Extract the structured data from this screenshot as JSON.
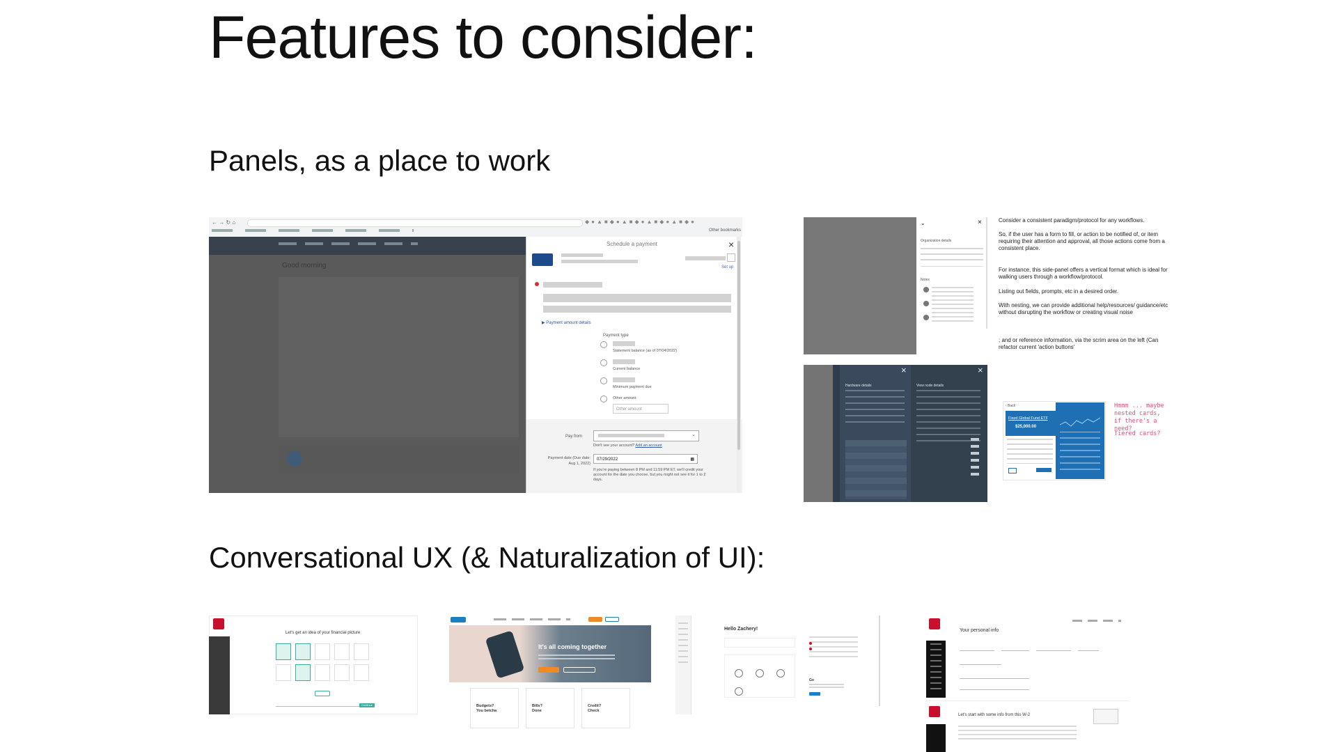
{
  "headings": {
    "title": "Features to consider:",
    "panels": "Panels, as a place to work",
    "conversational": "Conversational UX (& Naturalization of UI):"
  },
  "shot1": {
    "panel_title": "Schedule a payment",
    "setup": "Set up",
    "payment_details": "Payment amount details",
    "payment_type": "Payment type",
    "options": [
      "Statement balance (as of 07/04/2022)",
      "Current balance",
      "Minimum payment due",
      "Other amount"
    ],
    "other_amount_placeholder": "Other amount",
    "pay_from": "Pay from",
    "dont_see": "Don't see your account?",
    "add_account": "Add an account",
    "payment_date_label": "Payment date (Due date: Aug 1, 2022)",
    "payment_date": "07/29/2022",
    "note": "If you're paying between 8 PM and 11:59 PM ET, we'll credit your account for the date you choose, but you might not see it for 1 to 2 days.",
    "greeting": "Good morning",
    "other_bookmarks": "Other bookmarks"
  },
  "shot2": {
    "notes": [
      "Consider a consistent paradigm/protocol for any workflows.",
      "So, if the user has a form to fill, or action to be notified of, or item requiring their attention and approval, all those actions come from a consistent place.",
      "For instance, this side-panel offers a vertical format which is ideal for walking users through a workflow/protocol.",
      "Listing out fields, prompts, etc in a desired order.",
      "With nesting, we can provide additional help/resources/ guidance/etc without disrupting the workflow or creating visual noise",
      "; and or reference information, via the scrim area on the left (Can refactor current 'action buttons'"
    ],
    "org_details": "Organization details",
    "notes_label": "Notes",
    "hardware_details": "Hardware details",
    "view_node_details": "View node details",
    "fund_title": "Fixed Global Fund ETF",
    "fund_value": "$25,000.00",
    "pink_note_1": "Hmmm ... maybe nested cards, if there's a need?",
    "pink_note_2": "Tiered cards?"
  },
  "shot3": {
    "headline": "Let's get an idea of your financial picture",
    "continue": "Continue"
  },
  "shot4": {
    "hero": "It's all coming together",
    "cards": [
      "Budgets? You betcha",
      "Bills? Done",
      "Credit? Check"
    ]
  },
  "shot5": {
    "greeting": "Hello Zachery!",
    "caption": "Go"
  },
  "shot6": {
    "title": "Your personal info",
    "subtitle": "Let's start with some info from this W-2"
  },
  "colors": {
    "scrim": "#595959",
    "navy": "#3a4a5c",
    "blue": "#1f6fb5",
    "orange": "#f08a24",
    "teal": "#3aaea3",
    "pink": "#e0507a"
  }
}
